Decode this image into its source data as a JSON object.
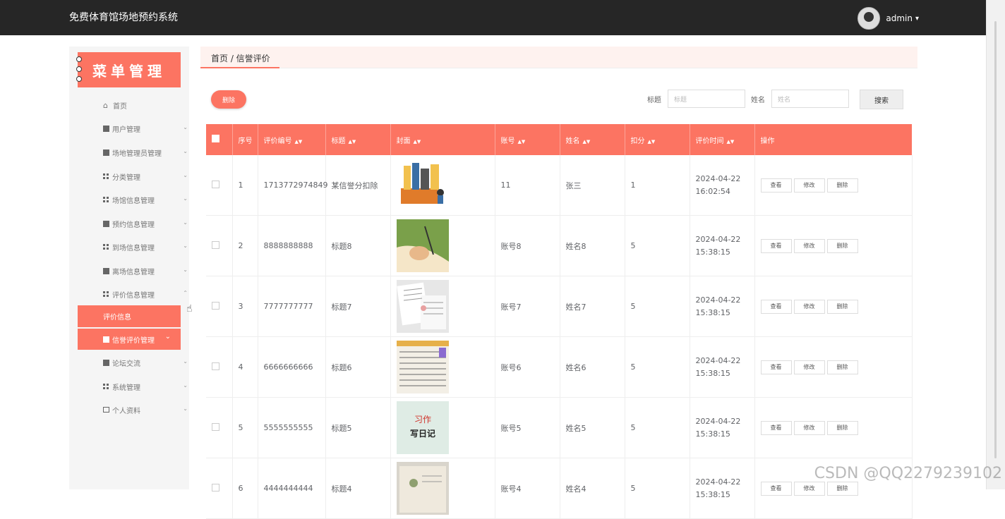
{
  "header": {
    "app_title": "免费体育馆场地预约系统",
    "username": "admin"
  },
  "sidebar": {
    "title": "菜单管理",
    "items": [
      {
        "label": "首页",
        "icon": "home-icon"
      },
      {
        "label": "用户管理",
        "icon": "user-icon"
      },
      {
        "label": "场地管理员管理",
        "icon": "user-icon"
      },
      {
        "label": "分类管理",
        "icon": "grid-icon"
      },
      {
        "label": "场馆信息管理",
        "icon": "grid-icon"
      },
      {
        "label": "预约信息管理",
        "icon": "book-icon"
      },
      {
        "label": "到场信息管理",
        "icon": "grid-icon"
      },
      {
        "label": "离场信息管理",
        "icon": "briefcase-icon"
      },
      {
        "label": "评价信息管理",
        "icon": "grid-icon"
      },
      {
        "label": "评价信息",
        "icon": ""
      },
      {
        "label": "信誉评价管理",
        "icon": "grid-icon"
      },
      {
        "label": "论坛交流",
        "icon": "chat-icon"
      },
      {
        "label": "系统管理",
        "icon": "grid-icon"
      },
      {
        "label": "个人资料",
        "icon": "card-icon"
      }
    ]
  },
  "breadcrumb": {
    "text": "首页 / 信誉评价"
  },
  "toolbar": {
    "delete_label": "删除",
    "search_button": "搜索"
  },
  "search": {
    "title_label": "标题",
    "title_placeholder": "标题",
    "name_label": "姓名",
    "name_placeholder": "姓名"
  },
  "table": {
    "headers": [
      "序号",
      "评价编号",
      "标题",
      "封面",
      "账号",
      "姓名",
      "扣分",
      "评价时间",
      "操作"
    ],
    "actions": {
      "view": "查看",
      "edit": "修改",
      "delete": "删除"
    },
    "rows": [
      {
        "no": "1",
        "code": "1713772974849",
        "title": "某信誉分扣除",
        "account": "11",
        "name": "张三",
        "points": "1",
        "time": "2024-04-22 16:02:54"
      },
      {
        "no": "2",
        "code": "8888888888",
        "title": "标题8",
        "account": "账号8",
        "name": "姓名8",
        "points": "5",
        "time": "2024-04-22 15:38:15"
      },
      {
        "no": "3",
        "code": "7777777777",
        "title": "标题7",
        "account": "账号7",
        "name": "姓名7",
        "points": "5",
        "time": "2024-04-22 15:38:15"
      },
      {
        "no": "4",
        "code": "6666666666",
        "title": "标题6",
        "account": "账号6",
        "name": "姓名6",
        "points": "5",
        "time": "2024-04-22 15:38:15"
      },
      {
        "no": "5",
        "code": "5555555555",
        "title": "标题5",
        "account": "账号5",
        "name": "姓名5",
        "points": "5",
        "time": "2024-04-22 15:38:15"
      },
      {
        "no": "6",
        "code": "4444444444",
        "title": "标题4",
        "account": "账号4",
        "name": "姓名4",
        "points": "5",
        "time": "2024-04-22 15:38:15"
      }
    ]
  },
  "cover5_text": {
    "line1": "习作",
    "line2": "写日记"
  },
  "watermark": "CSDN @QQ2279239102"
}
